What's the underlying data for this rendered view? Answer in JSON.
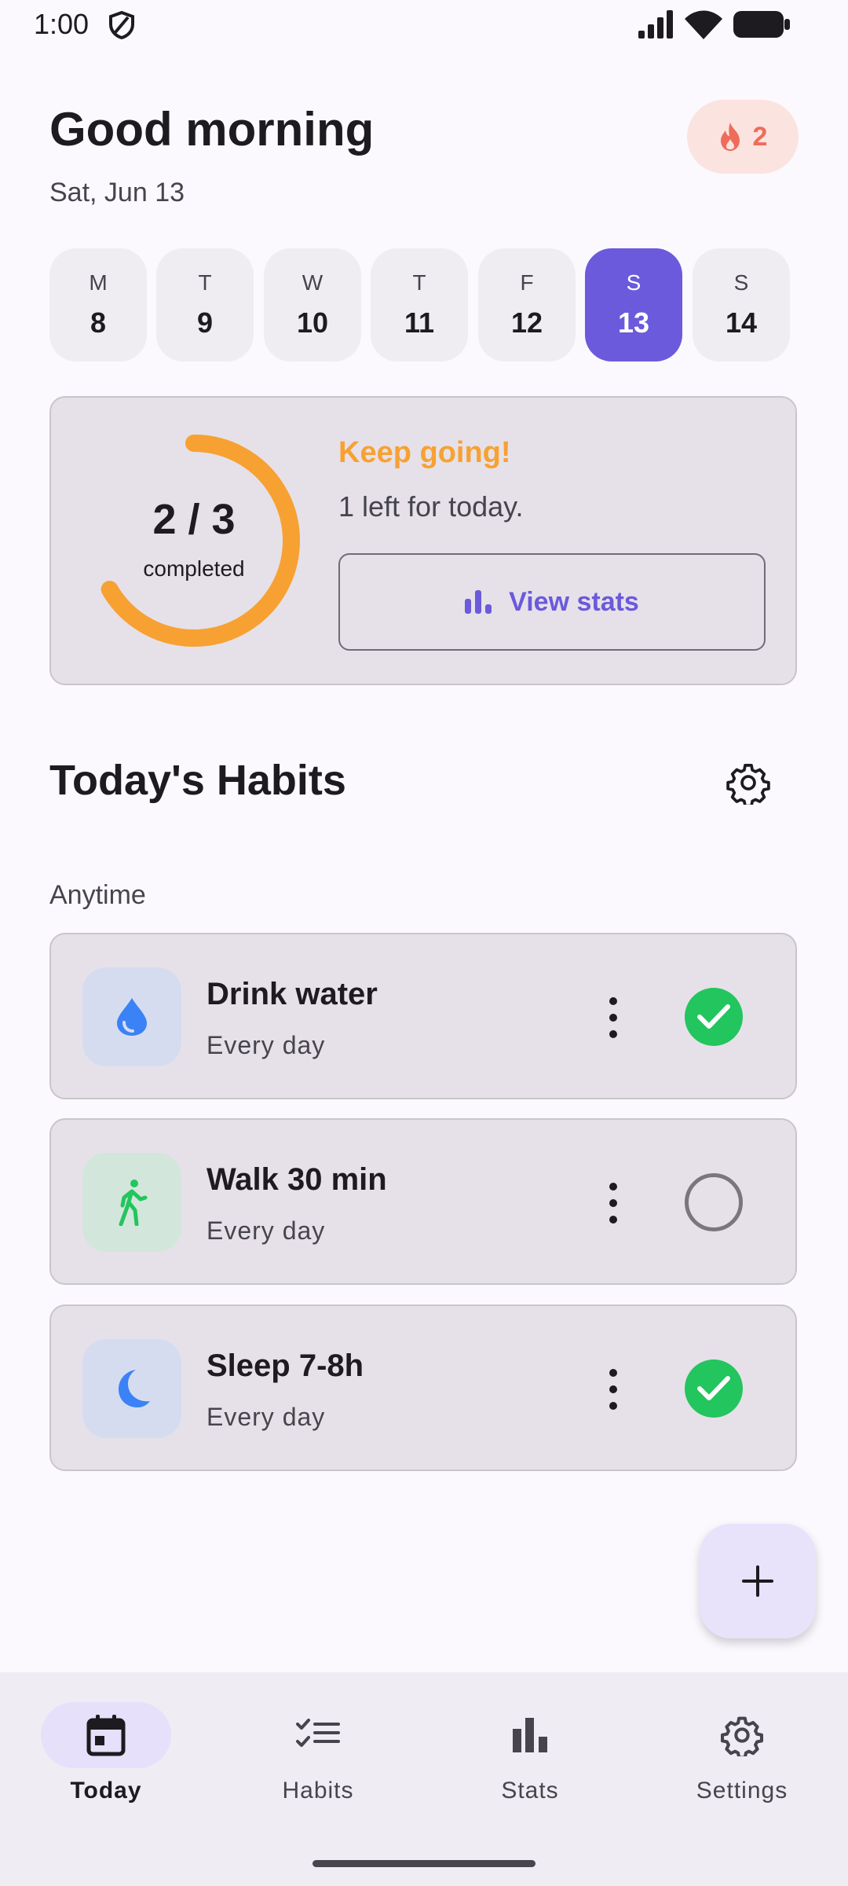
{
  "status_bar": {
    "time": "1:00",
    "icons": [
      "shield-icon",
      "signal-icon",
      "wifi-icon",
      "battery-icon"
    ]
  },
  "header": {
    "greeting": "Good morning",
    "date": "Sat, Jun 13",
    "streak": {
      "icon": "flame-icon",
      "count": "2",
      "color": "#ef6c5a"
    }
  },
  "week": {
    "days": [
      {
        "letter": "M",
        "number": "8",
        "selected": false
      },
      {
        "letter": "T",
        "number": "9",
        "selected": false
      },
      {
        "letter": "W",
        "number": "10",
        "selected": false
      },
      {
        "letter": "T",
        "number": "11",
        "selected": false
      },
      {
        "letter": "F",
        "number": "12",
        "selected": false
      },
      {
        "letter": "S",
        "number": "13",
        "selected": true
      },
      {
        "letter": "S",
        "number": "14",
        "selected": false
      }
    ]
  },
  "progress": {
    "completed": 2,
    "total": 3,
    "fraction_text": "2 / 3",
    "completed_label": "completed",
    "headline": "Keep going!",
    "remaining_text": "1 left for today.",
    "view_stats_label": "View stats",
    "ring_color": "#f7a133"
  },
  "habits_section": {
    "title": "Today's Habits",
    "group_label": "Anytime",
    "items": [
      {
        "name": "Drink water",
        "frequency": "Every day",
        "icon": "water-drop-icon",
        "done": true
      },
      {
        "name": "Walk 30 min",
        "frequency": "Every day",
        "icon": "walking-icon",
        "done": false
      },
      {
        "name": "Sleep 7-8h",
        "frequency": "Every day",
        "icon": "moon-icon",
        "done": true
      }
    ]
  },
  "colors": {
    "accent": "#6b5adb",
    "done": "#22c55e",
    "background": "#fbf9fe"
  },
  "nav": {
    "items": [
      {
        "label": "Today",
        "icon": "calendar-icon",
        "active": true
      },
      {
        "label": "Habits",
        "icon": "checklist-icon",
        "active": false
      },
      {
        "label": "Stats",
        "icon": "bar-chart-icon",
        "active": false
      },
      {
        "label": "Settings",
        "icon": "gear-icon",
        "active": false
      }
    ]
  }
}
